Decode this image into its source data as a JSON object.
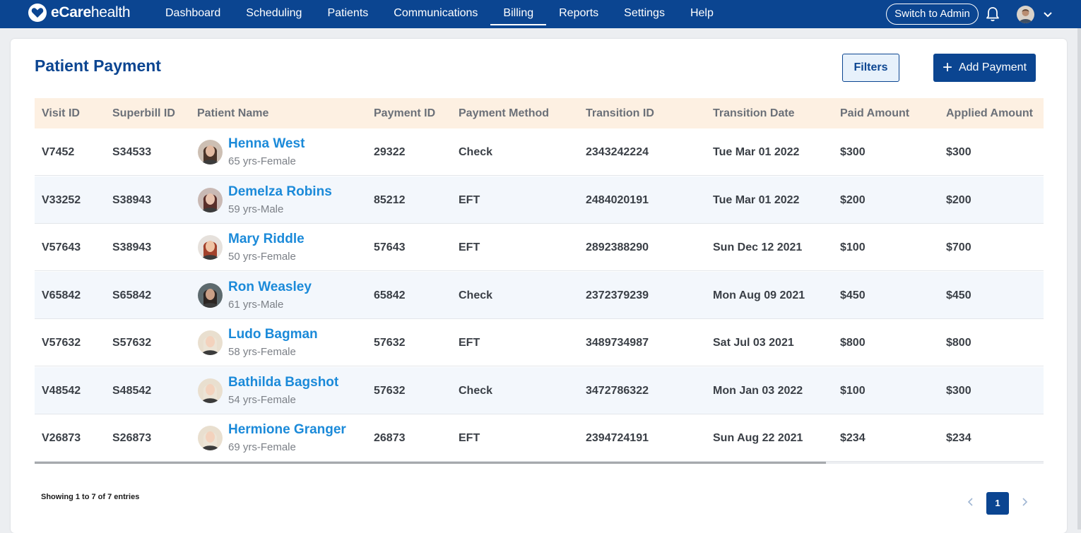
{
  "app": {
    "brand_prefix": "eCare",
    "brand_suffix": "health"
  },
  "nav": [
    {
      "label": "Dashboard",
      "active": false
    },
    {
      "label": "Scheduling",
      "active": false
    },
    {
      "label": "Patients",
      "active": false
    },
    {
      "label": "Communications",
      "active": false
    },
    {
      "label": "Billing",
      "active": true
    },
    {
      "label": "Reports",
      "active": false
    },
    {
      "label": "Settings",
      "active": false
    },
    {
      "label": "Help",
      "active": false
    }
  ],
  "header": {
    "switch_label": "Switch to Admin",
    "bell_icon": "bell-icon",
    "avatar_icon": "user-avatar",
    "menu_icon": "chevron-down-icon"
  },
  "page": {
    "title": "Patient Payment",
    "filters_label": "Filters",
    "add_label": "Add Payment",
    "add_icon": "plus-icon"
  },
  "table": {
    "columns": [
      "Visit ID",
      "Superbill ID",
      "Patient Name",
      "Payment ID",
      "Payment Method",
      "Transition ID",
      "Transition Date",
      "Paid Amount",
      "Applied Amount"
    ],
    "rows": [
      {
        "visit_id": "V7452",
        "superbill_id": "S34533",
        "name": "Henna West",
        "info": "65 yrs-Female",
        "payment_id": "29322",
        "method": "Check",
        "transition_id": "2343242224",
        "date": "Tue Mar 01 2022",
        "paid": "$300",
        "applied": "$300"
      },
      {
        "visit_id": "V33252",
        "superbill_id": "S38943",
        "name": "Demelza Robins",
        "info": "59 yrs-Male",
        "payment_id": "85212",
        "method": "EFT",
        "transition_id": "2484020191",
        "date": "Tue Mar 01 2022",
        "paid": "$200",
        "applied": "$200"
      },
      {
        "visit_id": "V57643",
        "superbill_id": "S38943",
        "name": "Mary Riddle",
        "info": "50 yrs-Female",
        "payment_id": "57643",
        "method": "EFT",
        "transition_id": "2892388290",
        "date": "Sun Dec 12 2021",
        "paid": "$100",
        "applied": "$700"
      },
      {
        "visit_id": "V65842",
        "superbill_id": "S65842",
        "name": "Ron Weasley",
        "info": "61 yrs-Male",
        "payment_id": "65842",
        "method": "Check",
        "transition_id": "2372379239",
        "date": "Mon Aug 09 2021",
        "paid": "$450",
        "applied": "$450"
      },
      {
        "visit_id": "V57632",
        "superbill_id": "S57632",
        "name": "Ludo Bagman",
        "info": "58 yrs-Female",
        "payment_id": "57632",
        "method": "EFT",
        "transition_id": "3489734987",
        "date": "Sat Jul 03 2021",
        "paid": "$800",
        "applied": "$800"
      },
      {
        "visit_id": "V48542",
        "superbill_id": "S48542",
        "name": "Bathilda Bagshot",
        "info": "54 yrs-Female",
        "payment_id": "57632",
        "method": "Check",
        "transition_id": "3472786322",
        "date": "Mon Jan 03 2022",
        "paid": "$100",
        "applied": "$300"
      },
      {
        "visit_id": "V26873",
        "superbill_id": "S26873",
        "name": "Hermione Granger",
        "info": "69 yrs-Female",
        "payment_id": "26873",
        "method": "EFT",
        "transition_id": "2394724191",
        "date": "Sun Aug 22 2021",
        "paid": "$234",
        "applied": "$234"
      }
    ]
  },
  "footer": {
    "entries_text": "Showing 1 to 7 of 7 entries",
    "current_page": "1",
    "prev_icon": "chevron-left-icon",
    "next_icon": "chevron-right-icon"
  },
  "colors": {
    "brand": "#0b4591",
    "link": "#1b8ad9",
    "header_bg": "#fdf0e2",
    "row_alt": "#f3f7fc"
  }
}
